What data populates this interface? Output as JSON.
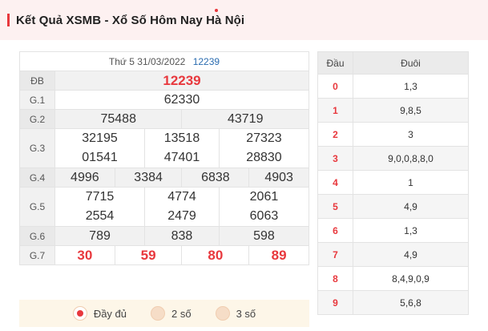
{
  "header": {
    "title": "Kết Quả XSMB - Xổ Số Hôm Nay Hà Nội"
  },
  "results": {
    "date": "Thứ 5 31/03/2022",
    "code": "12239",
    "rows": [
      {
        "label": "ĐB",
        "groups": [
          [
            "12239"
          ]
        ]
      },
      {
        "label": "G.1",
        "groups": [
          [
            "62330"
          ]
        ]
      },
      {
        "label": "G.2",
        "groups": [
          [
            "75488"
          ],
          [
            "43719"
          ]
        ]
      },
      {
        "label": "G.3",
        "groups": [
          [
            "32195",
            "01541"
          ],
          [
            "13518",
            "47401"
          ],
          [
            "27323",
            "28830"
          ]
        ]
      },
      {
        "label": "G.4",
        "groups": [
          [
            "4996"
          ],
          [
            "3384"
          ],
          [
            "6838"
          ],
          [
            "4903"
          ]
        ]
      },
      {
        "label": "G.5",
        "groups": [
          [
            "7715",
            "2554"
          ],
          [
            "4774",
            "2479"
          ],
          [
            "2061",
            "6063"
          ]
        ]
      },
      {
        "label": "G.6",
        "groups": [
          [
            "789"
          ],
          [
            "838"
          ],
          [
            "598"
          ]
        ]
      },
      {
        "label": "G.7",
        "groups": [
          [
            "30"
          ],
          [
            "59"
          ],
          [
            "80"
          ],
          [
            "89"
          ]
        ]
      }
    ]
  },
  "options": [
    {
      "label": "Đầy đủ",
      "selected": true
    },
    {
      "label": "2 số",
      "selected": false
    },
    {
      "label": "3 số",
      "selected": false
    }
  ],
  "loto": {
    "head_label": "Đầu",
    "tail_label": "Đuôi",
    "rows": [
      {
        "head": "0",
        "tail": "1,3"
      },
      {
        "head": "1",
        "tail": "9,8,5"
      },
      {
        "head": "2",
        "tail": "3"
      },
      {
        "head": "3",
        "tail": "9,0,0,8,8,0"
      },
      {
        "head": "4",
        "tail": "1"
      },
      {
        "head": "5",
        "tail": "4,9"
      },
      {
        "head": "6",
        "tail": "1,3"
      },
      {
        "head": "7",
        "tail": "4,9"
      },
      {
        "head": "8",
        "tail": "8,4,9,0,9"
      },
      {
        "head": "9",
        "tail": "5,6,8"
      }
    ]
  },
  "colors": {
    "accent": "#e8383d",
    "code_blue": "#2b6cb0",
    "option_bg": "#fdf6e8"
  }
}
